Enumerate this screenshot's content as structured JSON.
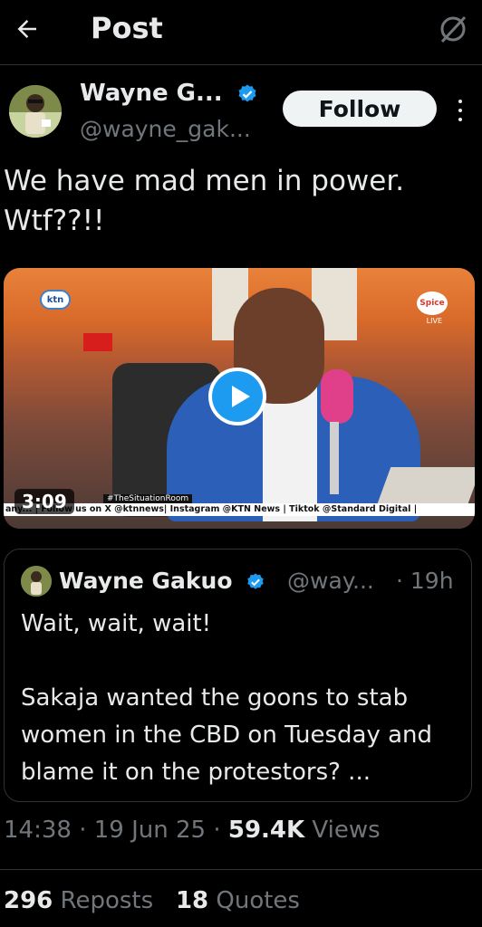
{
  "header": {
    "title": "Post",
    "back_icon": "arrow-left-icon",
    "grok_icon": "grok-icon"
  },
  "author": {
    "name": "Wayne G...",
    "handle": "@wayne_gak...",
    "verified": true,
    "follow_label": "Follow"
  },
  "tweet": {
    "text": "We have mad men in power.\nWtf??!!"
  },
  "video": {
    "duration": "3:09",
    "channel_logo": "ktn",
    "station_logo": "Spice",
    "live_label": "LIVE",
    "tag": "#TheSituationRoom",
    "ticker": "any... | Follow us on X @ktnnews| Instagram @KTN News | Tiktok @Standard Digital |"
  },
  "quote": {
    "name": "Wayne Gakuo",
    "handle": "@way...",
    "time": "· 19h",
    "text": "Wait, wait, wait!\n\nSakaja wanted the goons to stab women in the CBD on Tuesday and blame it on the protestors? ..."
  },
  "meta": {
    "time": "14:38",
    "date": "19 Jun 25",
    "views_count": "59.4K",
    "views_label": "Views"
  },
  "stats": {
    "reposts_count": "296",
    "reposts_label": "Reposts",
    "quotes_count": "18",
    "quotes_label": "Quotes"
  },
  "colors": {
    "background": "#000000",
    "verified": "#1d9bf0",
    "muted": "#71767b",
    "text": "#e7e9ea"
  }
}
